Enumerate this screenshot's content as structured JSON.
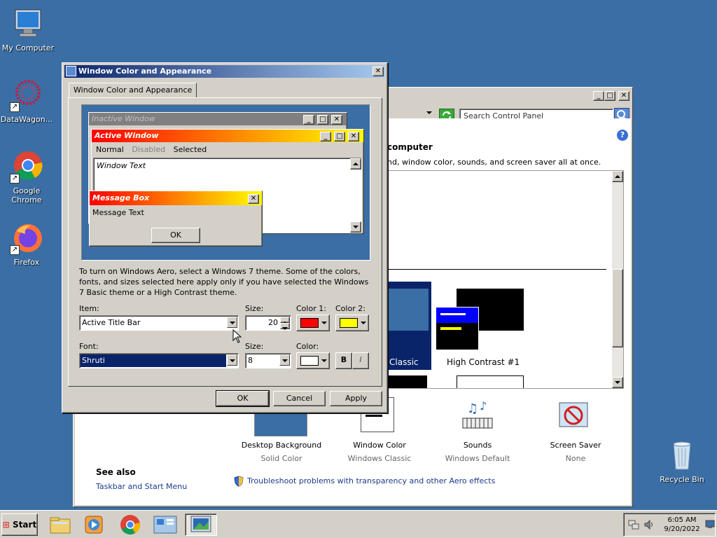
{
  "desktop": {
    "icons": [
      {
        "label": "My Computer"
      },
      {
        "label": "DataWagon..."
      },
      {
        "label": "Google Chrome"
      },
      {
        "label": "Firefox"
      },
      {
        "label": "Recycle Bin"
      }
    ]
  },
  "control_panel": {
    "search_placeholder": "Search Control Panel",
    "heading": "computer",
    "description": "nd, window color, sounds, and screen saver all at once.",
    "themes": [
      {
        "label": "Classic"
      },
      {
        "label": "High Contrast #1"
      }
    ],
    "bottom_items": [
      {
        "title": "Desktop Background",
        "subtitle": "Solid Color"
      },
      {
        "title": "Window Color",
        "subtitle": "Windows Classic"
      },
      {
        "title": "Sounds",
        "subtitle": "Windows Default"
      },
      {
        "title": "Screen Saver",
        "subtitle": "None"
      }
    ],
    "see_also": "See also",
    "taskbar_link": "Taskbar and Start Menu",
    "troubleshoot_link": "Troubleshoot problems with transparency and other Aero effects"
  },
  "dialog": {
    "title": "Window Color and Appearance",
    "tab": "Window Color and Appearance",
    "preview": {
      "inactive": "Inactive Window",
      "active": "Active Window",
      "menu": [
        "Normal",
        "Disabled",
        "Selected"
      ],
      "window_text": "Window Text",
      "msgbox_title": "Message Box",
      "msgbox_text": "Message Text",
      "ok": "OK"
    },
    "info": "To turn on Windows Aero, select a Windows 7 theme.  Some of the colors, fonts, and sizes selected here apply only if you have selected the Windows 7 Basic theme or a High Contrast theme.",
    "item_label": "Item:",
    "item_value": "Active Title Bar",
    "size_label": "Size:",
    "size_value": "20",
    "color1_label": "Color 1:",
    "color2_label": "Color 2:",
    "color1": "#ff0000",
    "color2": "#ffff00",
    "font_label": "Font:",
    "font_value": "Shruti",
    "font_size_label": "Size:",
    "font_size_value": "8",
    "font_color_label": "Color:",
    "font_color": "#ffffff",
    "bold": "B",
    "italic": "I",
    "ok": "OK",
    "cancel": "Cancel",
    "apply": "Apply"
  },
  "taskbar": {
    "start": "Start",
    "time": "6:05 AM",
    "date": "9/20/2022"
  }
}
